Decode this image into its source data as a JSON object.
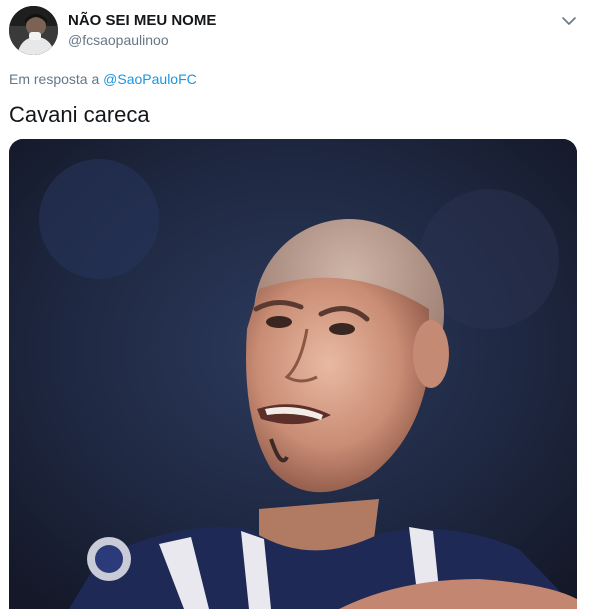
{
  "tweet": {
    "display_name": "NÃO SEI MEU NOME",
    "handle": "@fcsaopaulinoo",
    "reply_prefix": "Em resposta a",
    "reply_to": "@SaoPauloFC",
    "text": "Cavani careca"
  },
  "icons": {
    "menu": "chevron-down-icon"
  },
  "colors": {
    "link": "#1b95e0",
    "secondary_text": "#657786",
    "primary_text": "#14171a"
  }
}
